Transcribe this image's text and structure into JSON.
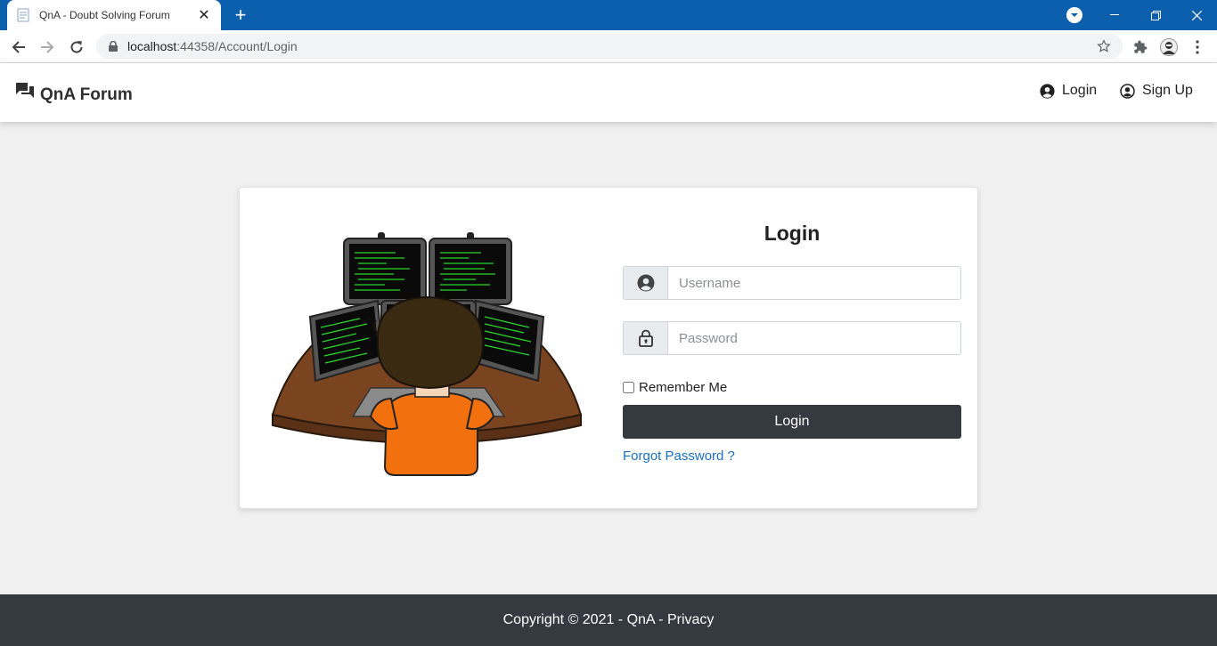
{
  "browser": {
    "tab_title": "QnA - Doubt Solving Forum",
    "url_host": "localhost",
    "url_rest": ":44358/Account/Login",
    "accent": "#0b5fad"
  },
  "navbar": {
    "brand": "QnA Forum",
    "login_label": "Login",
    "signup_label": "Sign Up"
  },
  "login_form": {
    "title": "Login",
    "username_placeholder": "Username",
    "password_placeholder": "Password",
    "remember_label": "Remember Me",
    "remember_checked": false,
    "submit_label": "Login",
    "forgot_label": "Forgot Password ?",
    "link_color": "#1a6fc0",
    "button_color": "#343a40"
  },
  "footer": {
    "copyright": "Copyright © 2021 - QnA - ",
    "privacy_label": "Privacy"
  },
  "icons": {
    "brand": "chat-bubbles-icon",
    "login": "user-circle-icon",
    "signup": "user-circle-outline-icon",
    "username": "user-circle-icon",
    "password": "lock-icon"
  }
}
